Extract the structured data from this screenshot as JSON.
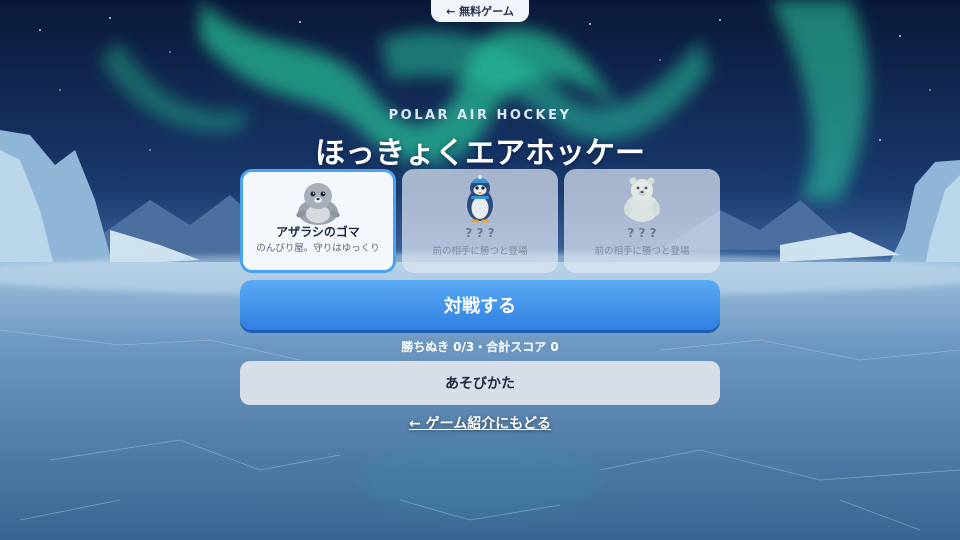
{
  "header": {
    "back_label": "← 無料ゲーム"
  },
  "subtitle": "POLAR AIR HOCKEY",
  "title": "ほっきょくエアホッケー",
  "opponents": [
    {
      "name": "アザラシのゴマ",
      "desc": "のんびり屋。守りはゆっくり",
      "icon": "seal-icon",
      "selected": true,
      "locked": false
    },
    {
      "name": "? ? ?",
      "desc": "前の相手に勝つと登場",
      "icon": "penguin-icon",
      "selected": false,
      "locked": true
    },
    {
      "name": "? ? ?",
      "desc": "前の相手に勝つと登場",
      "icon": "polar-bear-icon",
      "selected": false,
      "locked": true
    }
  ],
  "battle_label": "対戦する",
  "progress_text": "勝ちぬき 0/3・合計スコア 0",
  "howto_label": "あそびかた",
  "intro_link": "← ゲーム紹介にもどる",
  "colors": {
    "accent": "#3a8ff0",
    "card_border": "#4aa3f0",
    "secondary_button": "#d7dee8"
  }
}
